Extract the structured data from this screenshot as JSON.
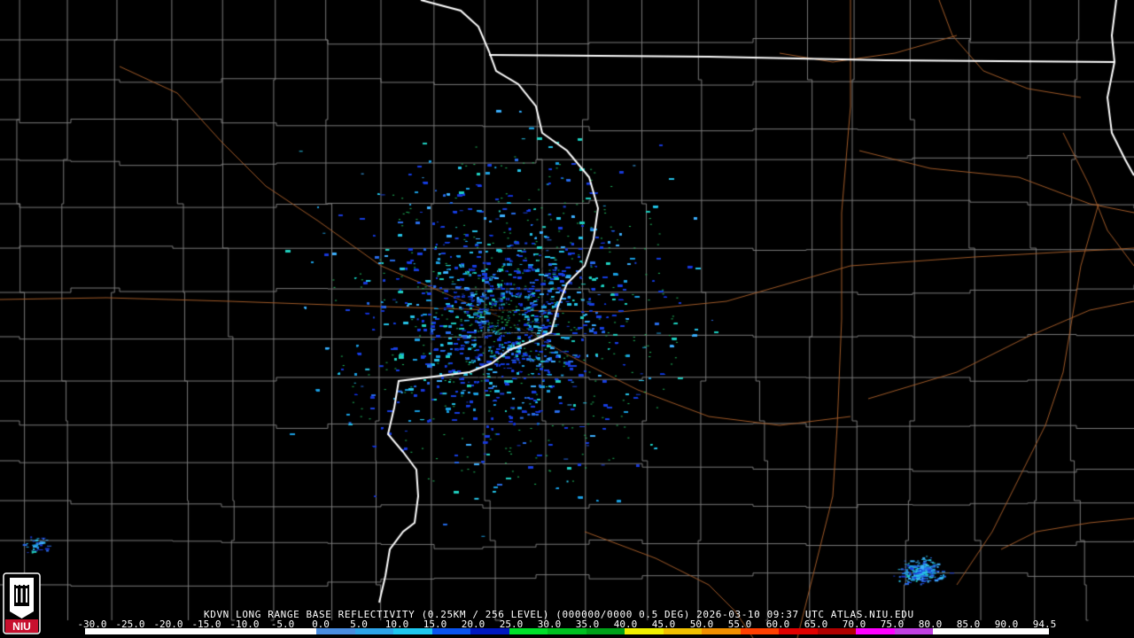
{
  "header": {
    "caption": "KDVN LONG RANGE BASE REFLECTIVITY (0.25KM / 256 LEVEL) (000000/0000 0.5 DEG) 2026-03-10 09:37 UTC  ATLAS.NIU.EDU"
  },
  "legend": {
    "ticks": [
      "-30.0",
      "-25.0",
      "-20.0",
      "-15.0",
      "-10.0",
      "-5.0",
      "0.0",
      "5.0",
      "10.0",
      "15.0",
      "20.0",
      "25.0",
      "30.0",
      "35.0",
      "40.0",
      "45.0",
      "50.0",
      "55.0",
      "60.0",
      "65.0",
      "70.0",
      "75.0",
      "80.0",
      "85.0",
      "90.0",
      "94.5"
    ],
    "colors": [
      "#ffffff",
      "#ffffff",
      "#ffffff",
      "#ffffff",
      "#ffffff",
      "#ffffff",
      "#4a8de0",
      "#2ea4e8",
      "#1ec8f0",
      "#0a54f0",
      "#0018c0",
      "#00e02a",
      "#00c020",
      "#00a018",
      "#f0f000",
      "#f0c000",
      "#f09000",
      "#ff4000",
      "#e00000",
      "#b00000",
      "#ff00ff",
      "#c040e0",
      "#ffffff",
      "#ffffff",
      "#ffffff"
    ]
  },
  "logo": {
    "text": "NIU",
    "color": "#c8102e"
  },
  "map": {
    "background": "#000000",
    "border_color": "#ffffff",
    "county_color": "#7a7a7a",
    "road_color": "#a05a28",
    "echo_colors": [
      "#1e9fe0",
      "#2a6de8",
      "#28c4e8",
      "#1a3ad8",
      "#3fb0ff",
      "#22d0c0"
    ]
  }
}
